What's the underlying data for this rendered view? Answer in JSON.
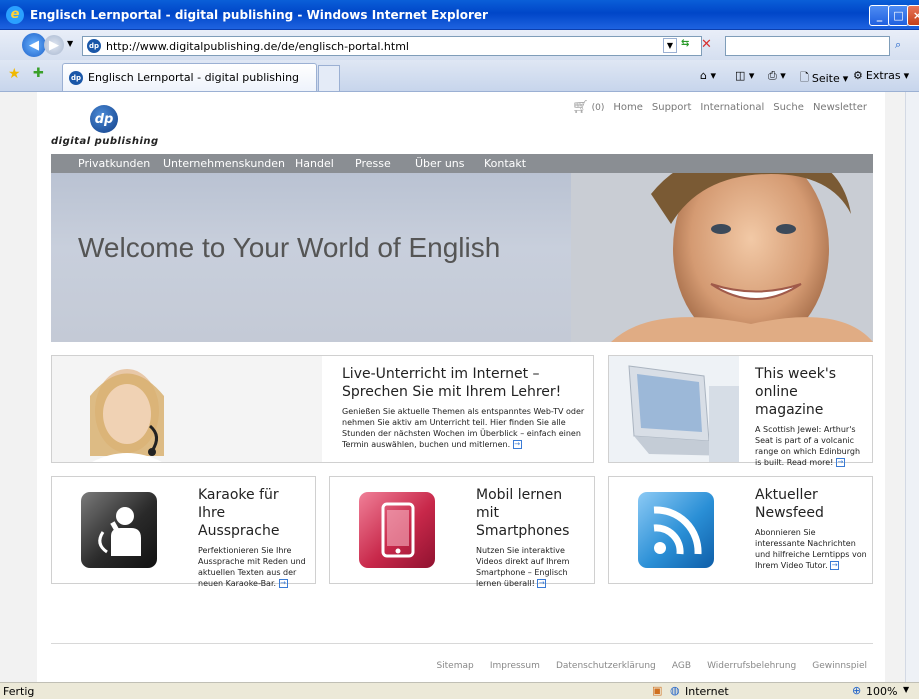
{
  "window": {
    "title": "Englisch Lernportal - digital publishing - Windows Internet Explorer"
  },
  "address": {
    "url": "http://www.digitalpublishing.de/de/englisch-portal.html"
  },
  "tab": {
    "label": "Englisch Lernportal - digital publishing"
  },
  "toolbar": {
    "page_label": "Seite",
    "extras_label": "Extras"
  },
  "site": {
    "logo_text": "dp",
    "brand": "digital publishing",
    "cart": "(0)",
    "top_links": [
      "Home",
      "Support",
      "International",
      "Suche",
      "Newsletter"
    ],
    "nav": [
      "Privatkunden",
      "Unternehmenskunden",
      "Handel",
      "Presse",
      "Über uns",
      "Kontakt"
    ],
    "hero_title": "Welcome to Your World of English"
  },
  "cards": {
    "live": {
      "title_line1": "Live-Unterricht im Internet –",
      "title_line2": "Sprechen Sie mit Ihrem Lehrer!",
      "text": "Genießen Sie aktuelle Themen als entspanntes Web-TV oder nehmen Sie aktiv am Unterricht teil. Hier finden Sie alle Stunden der nächsten Wochen im Überblick – einfach einen Termin auswählen, buchen und mitlernen."
    },
    "magazine": {
      "title_line1": "This week's",
      "title_line2": "online magazine",
      "text": "A Scottish Jewel: Arthur's Seat is part of a volcanic range on which Edinburgh is built. Read more!"
    },
    "karaoke": {
      "title_line1": "Karaoke für Ihre",
      "title_line2": "Aussprache",
      "text": "Perfektionieren Sie Ihre Aussprache mit Reden und aktuellen Texten aus der neuen Karaoke-Bar."
    },
    "mobile": {
      "title_line1": "Mobil lernen mit",
      "title_line2": "Smartphones",
      "text": "Nutzen Sie interaktive Videos direkt auf Ihrem Smartphone – Englisch lernen überall!"
    },
    "news": {
      "title_line1": "Aktueller",
      "title_line2": "Newsfeed",
      "text": "Abonnieren Sie interessante Nachrichten und hilfreiche Lerntipps von Ihrem Video Tutor."
    }
  },
  "footer": {
    "links": [
      "Sitemap",
      "Impressum",
      "Datenschutzerklärung",
      "AGB",
      "Widerrufsbelehrung",
      "Gewinnspiel"
    ]
  },
  "status": {
    "left": "Fertig",
    "zone": "Internet",
    "zoom": "100%"
  },
  "colors": {
    "accent": "#3a7bd5",
    "nav": "#8a8e93",
    "karaoke": "#3a3a3a",
    "mobile": "#c8284a",
    "news": "#2a8fd6"
  }
}
